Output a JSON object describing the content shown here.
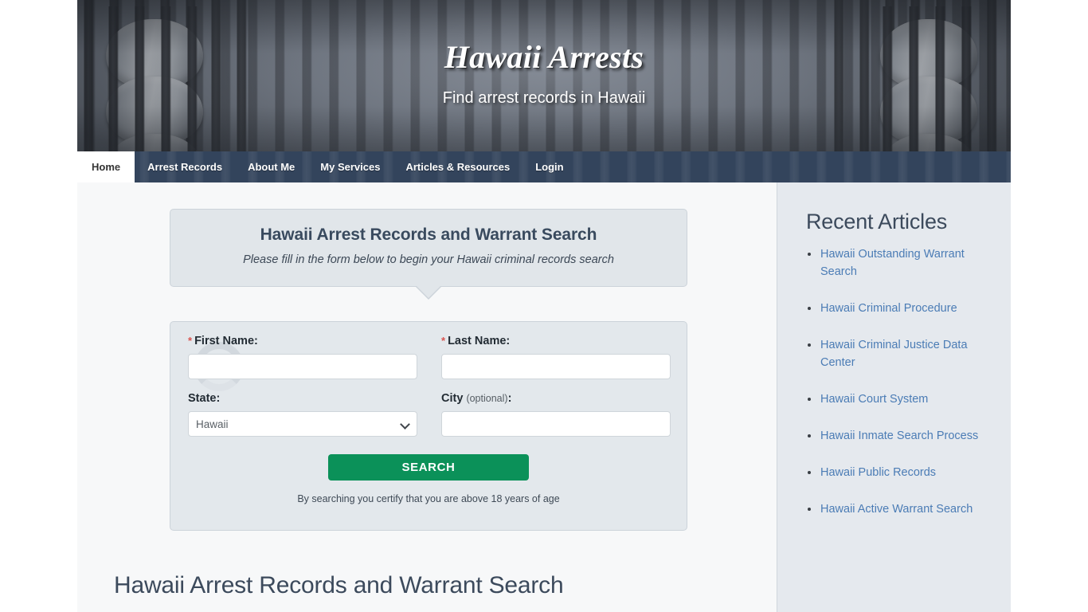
{
  "header": {
    "title": "Hawaii Arrests",
    "tagline": "Find arrest records in Hawaii"
  },
  "nav": {
    "items": [
      {
        "label": "Home",
        "active": true
      },
      {
        "label": "Arrest Records",
        "active": false
      },
      {
        "label": "About Me",
        "active": false
      },
      {
        "label": "My Services",
        "active": false
      },
      {
        "label": "Articles & Resources",
        "active": false
      },
      {
        "label": "Login",
        "active": false
      }
    ]
  },
  "callout": {
    "title": "Hawaii Arrest Records and Warrant Search",
    "subtitle": "Please fill in the form below to begin your Hawaii criminal records search"
  },
  "form": {
    "first_name": {
      "label": "First Name:",
      "required_marker": "*",
      "value": "",
      "placeholder": ""
    },
    "last_name": {
      "label": "Last Name:",
      "required_marker": "*",
      "value": "",
      "placeholder": ""
    },
    "state": {
      "label": "State:",
      "selected": "Hawaii",
      "options": [
        "Hawaii"
      ]
    },
    "city": {
      "label": "City",
      "optional_note": "(optional)",
      "colon": ":",
      "value": "",
      "placeholder": ""
    },
    "search_button": "SEARCH",
    "disclaimer": "By searching you certify that you are above 18 years of age"
  },
  "main": {
    "page_heading": "Hawaii Arrest Records and Warrant Search"
  },
  "sidebar": {
    "title": "Recent Articles",
    "articles": [
      "Hawaii Outstanding Warrant Search",
      "Hawaii Criminal Procedure",
      "Hawaii Criminal Justice Data Center",
      "Hawaii Court System",
      "Hawaii Inmate Search Process",
      "Hawaii Public Records",
      "Hawaii Active Warrant Search"
    ]
  },
  "colors": {
    "nav_bg": "#33445c",
    "panel_bg": "#e3e8ec",
    "sidebar_bg": "#e5e9ee",
    "link": "#4b7cb5",
    "search_button": "#0b9159",
    "heading": "#3c4a5c",
    "required": "#d9534f"
  }
}
